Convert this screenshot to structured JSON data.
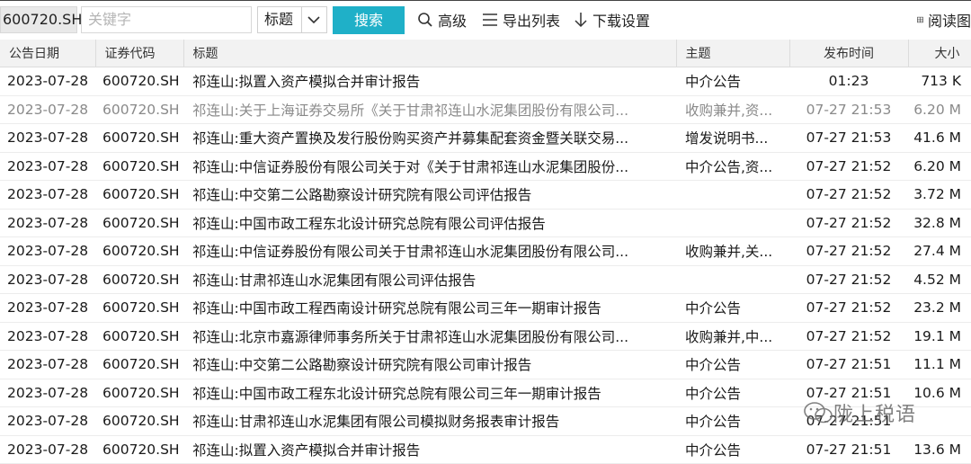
{
  "toolbar": {
    "stock_code": "600720.SH",
    "keyword_placeholder": "关键字",
    "field_select": "标题",
    "search_label": "搜索",
    "advanced_label": "高级",
    "export_label": "导出列表",
    "download_settings_label": "下载设置",
    "reading_label": "阅读图"
  },
  "table": {
    "headers": [
      "公告日期",
      "证券代码",
      "标题",
      "主题",
      "发布时间",
      "大小"
    ],
    "rows": [
      {
        "date": "2023-07-28",
        "code": "600720.SH",
        "title": "祁连山:拟置入资产模拟合并审计报告",
        "topic": "中介公告",
        "time": "01:23",
        "size": "713 K",
        "grey": false
      },
      {
        "date": "2023-07-28",
        "code": "600720.SH",
        "title": "祁连山:关于上海证券交易所《关于甘肃祁连山水泥集团股份有限公司...",
        "topic": "收购兼并,资...",
        "time": "07-27 21:53",
        "size": "6.20 M",
        "grey": true
      },
      {
        "date": "2023-07-28",
        "code": "600720.SH",
        "title": "祁连山:重大资产置换及发行股份购买资产并募集配套资金暨关联交易...",
        "topic": "增发说明书...",
        "time": "07-27 21:53",
        "size": "41.6 M",
        "grey": false
      },
      {
        "date": "2023-07-28",
        "code": "600720.SH",
        "title": "祁连山:中信证券股份有限公司关于对《关于甘肃祁连山水泥集团股份...",
        "topic": "中介公告,资...",
        "time": "07-27 21:52",
        "size": "6.20 M",
        "grey": false
      },
      {
        "date": "2023-07-28",
        "code": "600720.SH",
        "title": "祁连山:中交第二公路勘察设计研究院有限公司评估报告",
        "topic": "",
        "time": "07-27 21:52",
        "size": "3.72 M",
        "grey": false
      },
      {
        "date": "2023-07-28",
        "code": "600720.SH",
        "title": "祁连山:中国市政工程东北设计研究总院有限公司评估报告",
        "topic": "",
        "time": "07-27 21:52",
        "size": "32.8 M",
        "grey": false
      },
      {
        "date": "2023-07-28",
        "code": "600720.SH",
        "title": "祁连山:中信证券股份有限公司关于甘肃祁连山水泥集团股份有限公司...",
        "topic": "收购兼并,关...",
        "time": "07-27 21:52",
        "size": "27.4 M",
        "grey": false
      },
      {
        "date": "2023-07-28",
        "code": "600720.SH",
        "title": "祁连山:甘肃祁连山水泥集团有限公司评估报告",
        "topic": "",
        "time": "07-27 21:52",
        "size": "4.52 M",
        "grey": false
      },
      {
        "date": "2023-07-28",
        "code": "600720.SH",
        "title": "祁连山:中国市政工程西南设计研究总院有限公司三年一期审计报告",
        "topic": "中介公告",
        "time": "07-27 21:52",
        "size": "23.2 M",
        "grey": false
      },
      {
        "date": "2023-07-28",
        "code": "600720.SH",
        "title": "祁连山:北京市嘉源律师事务所关于甘肃祁连山水泥集团股份有限公司...",
        "topic": "收购兼并,中...",
        "time": "07-27 21:52",
        "size": "19.1 M",
        "grey": false
      },
      {
        "date": "2023-07-28",
        "code": "600720.SH",
        "title": "祁连山:中交第二公路勘察设计研究院有限公司审计报告",
        "topic": "中介公告",
        "time": "07-27 21:51",
        "size": "11.1 M",
        "grey": false
      },
      {
        "date": "2023-07-28",
        "code": "600720.SH",
        "title": "祁连山:中国市政工程东北设计研究总院有限公司三年一期审计报告",
        "topic": "中介公告",
        "time": "07-27 21:51",
        "size": "10.6 M",
        "grey": false
      },
      {
        "date": "2023-07-28",
        "code": "600720.SH",
        "title": "祁连山:甘肃祁连山水泥集团有限公司模拟财务报表审计报告",
        "topic": "中介公告",
        "time": "07-27 21:51",
        "size": "",
        "grey": false
      },
      {
        "date": "2023-07-28",
        "code": "600720.SH",
        "title": "祁连山:拟置入资产模拟合并审计报告",
        "topic": "中介公告",
        "time": "07-27 21:51",
        "size": "13.6 M",
        "grey": false
      }
    ]
  },
  "watermark": {
    "text": "陇上税语"
  },
  "colors": {
    "search_button": "#1fb0c8",
    "header_bg": "#f2f2f2",
    "grey_row_text": "#8a8a8a"
  }
}
